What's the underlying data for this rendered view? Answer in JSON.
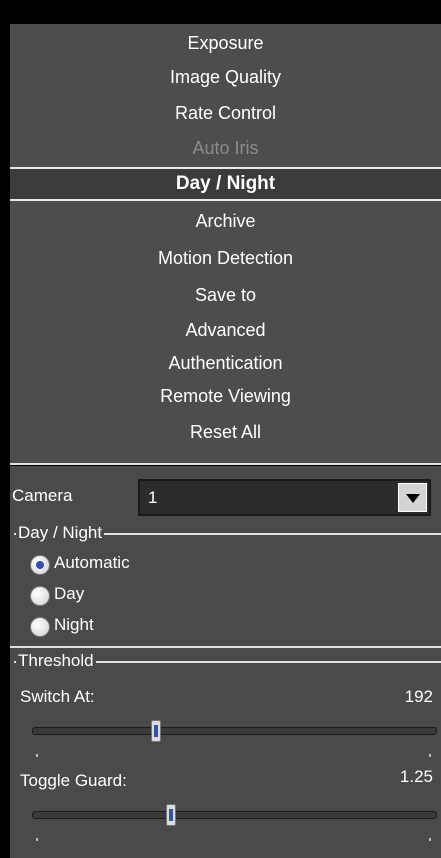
{
  "menu": {
    "items": [
      {
        "label": "Exposure",
        "state": "normal"
      },
      {
        "label": "Image Quality",
        "state": "normal"
      },
      {
        "label": "Rate Control",
        "state": "normal"
      },
      {
        "label": "Auto Iris",
        "state": "disabled"
      },
      {
        "label": "Day / Night",
        "state": "selected"
      },
      {
        "label": "Archive",
        "state": "normal"
      },
      {
        "label": "Motion Detection",
        "state": "normal"
      },
      {
        "label": "Save to",
        "state": "normal"
      },
      {
        "label": "Advanced",
        "state": "normal"
      },
      {
        "label": "Authentication",
        "state": "normal"
      },
      {
        "label": "Remote Viewing",
        "state": "normal"
      },
      {
        "label": "Reset All",
        "state": "normal"
      }
    ]
  },
  "camera": {
    "label": "Camera",
    "selected": "1"
  },
  "day_night": {
    "title": "Day / Night",
    "options": [
      {
        "label": "Automatic",
        "checked": true
      },
      {
        "label": "Day",
        "checked": false
      },
      {
        "label": "Night",
        "checked": false
      }
    ]
  },
  "threshold": {
    "title": "Threshold",
    "switch_at": {
      "label": "Switch At:",
      "value": "192",
      "fraction": 0.3
    },
    "toggle_guard": {
      "label": "Toggle Guard:",
      "value": "1.25",
      "fraction": 0.34
    }
  },
  "colors": {
    "accent": "#2f54a8",
    "panel_bg": "#4a4a4a",
    "disabled_text": "#8b8b8b"
  }
}
